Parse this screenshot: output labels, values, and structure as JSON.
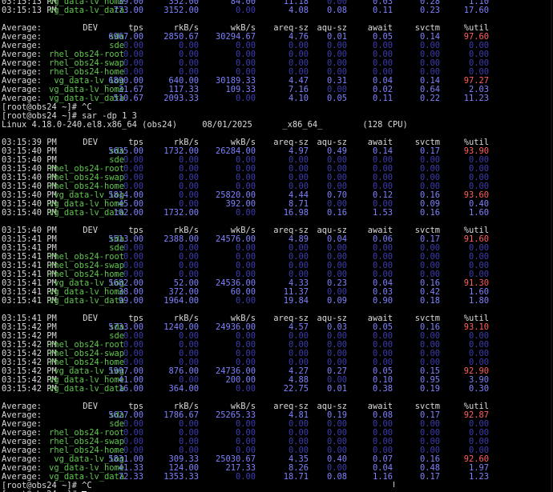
{
  "terminal": {
    "prompt": "[root@obs24 ~]# ",
    "lines": [
      {
        "k": "row",
        "time": "03:15:13 PM",
        "dev": "vg_data-lv_home",
        "v": [
          "39.00",
          "352.00",
          "84.00",
          "11.18",
          "0.00",
          "0.03",
          "0.28",
          "1.10"
        ]
      },
      {
        "k": "row",
        "time": "03:15:13 PM",
        "dev": "vg_data-lv_data",
        "v": [
          "773.00",
          "3152.00",
          "0.00",
          "4.08",
          "0.08",
          "0.11",
          "0.23",
          "17.60"
        ]
      },
      {
        "k": "blank"
      },
      {
        "k": "header",
        "time": "Average:",
        "cols": [
          "DEV",
          "tps",
          "rkB/s",
          "wkB/s",
          "areq-sz",
          "aqu-sz",
          "await",
          "svctm",
          "%util"
        ]
      },
      {
        "k": "row",
        "time": "Average:",
        "dev": "sda",
        "v": [
          "6967.00",
          "2850.67",
          "30294.67",
          "4.76",
          "0.01",
          "0.05",
          "0.14",
          "97.60"
        ]
      },
      {
        "k": "row",
        "time": "Average:",
        "dev": "sde",
        "v": [
          "0.00",
          "0.00",
          "0.00",
          "0.00",
          "0.00",
          "0.00",
          "0.00",
          "0.00"
        ]
      },
      {
        "k": "row",
        "time": "Average:",
        "dev": "rhel_obs24-root",
        "v": [
          "0.00",
          "0.00",
          "0.00",
          "0.00",
          "0.00",
          "0.00",
          "0.00",
          "0.00"
        ]
      },
      {
        "k": "row",
        "time": "Average:",
        "dev": "rhel_obs24-swap",
        "v": [
          "0.00",
          "0.00",
          "0.00",
          "0.00",
          "0.00",
          "0.00",
          "0.00",
          "0.00"
        ]
      },
      {
        "k": "row",
        "time": "Average:",
        "dev": "rhel_obs24-home",
        "v": [
          "0.00",
          "0.00",
          "0.00",
          "0.00",
          "0.00",
          "0.00",
          "0.00",
          "0.00"
        ]
      },
      {
        "k": "row",
        "time": "Average:",
        "dev": "vg_data-lv_log",
        "v": [
          "6890.00",
          "640.00",
          "30189.33",
          "4.47",
          "0.31",
          "0.04",
          "0.14",
          "97.27"
        ]
      },
      {
        "k": "row",
        "time": "Average:",
        "dev": "vg_data-lv_home",
        "v": [
          "31.67",
          "117.33",
          "109.33",
          "7.16",
          "0.00",
          "0.02",
          "0.64",
          "2.03"
        ]
      },
      {
        "k": "row",
        "time": "Average:",
        "dev": "vg_data-lv_data",
        "v": [
          "510.67",
          "2093.33",
          "0.00",
          "4.10",
          "0.05",
          "0.11",
          "0.22",
          "11.23"
        ]
      },
      {
        "k": "cmd",
        "text": "^C"
      },
      {
        "k": "cmd",
        "text": "sar -dp 1 3"
      },
      {
        "k": "text",
        "text": "Linux 4.18.0-240.el8.x86_64 (obs24)     08/01/2025      _x86_64_        (128 CPU)"
      },
      {
        "k": "blank"
      },
      {
        "k": "header",
        "time": "03:15:39 PM",
        "cols": [
          "DEV",
          "tps",
          "rkB/s",
          "wkB/s",
          "areq-sz",
          "aqu-sz",
          "await",
          "svctm",
          "%util"
        ]
      },
      {
        "k": "row",
        "time": "03:15:40 PM",
        "dev": "sda",
        "v": [
          "5635.00",
          "1732.00",
          "26284.00",
          "4.97",
          "0.49",
          "0.14",
          "0.17",
          "93.90"
        ]
      },
      {
        "k": "row",
        "time": "03:15:40 PM",
        "dev": "sde",
        "v": [
          "0.00",
          "0.00",
          "0.00",
          "0.00",
          "0.00",
          "0.00",
          "0.00",
          "0.00"
        ]
      },
      {
        "k": "row",
        "time": "03:15:40 PM",
        "dev": "rhel_obs24-root",
        "v": [
          "0.00",
          "0.00",
          "0.00",
          "0.00",
          "0.00",
          "0.00",
          "0.00",
          "0.00"
        ]
      },
      {
        "k": "row",
        "time": "03:15:40 PM",
        "dev": "rhel_obs24-swap",
        "v": [
          "0.00",
          "0.00",
          "0.00",
          "0.00",
          "0.00",
          "0.00",
          "0.00",
          "0.00"
        ]
      },
      {
        "k": "row",
        "time": "03:15:40 PM",
        "dev": "rhel_obs24-home",
        "v": [
          "0.00",
          "0.00",
          "0.00",
          "0.00",
          "0.00",
          "0.00",
          "0.00",
          "0.00"
        ]
      },
      {
        "k": "row",
        "time": "03:15:40 PM",
        "dev": "vg_data-lv_log",
        "v": [
          "5814.00",
          "0.00",
          "25820.00",
          "4.44",
          "0.70",
          "0.12",
          "0.16",
          "93.60"
        ]
      },
      {
        "k": "row",
        "time": "03:15:40 PM",
        "dev": "vg_data-lv_home",
        "v": [
          "45.00",
          "0.00",
          "392.00",
          "8.71",
          "0.00",
          "0.00",
          "0.09",
          "0.40"
        ]
      },
      {
        "k": "row",
        "time": "03:15:40 PM",
        "dev": "vg_data-lv_data",
        "v": [
          "102.00",
          "1732.00",
          "0.00",
          "16.98",
          "0.16",
          "1.53",
          "0.16",
          "1.60"
        ]
      },
      {
        "k": "blank"
      },
      {
        "k": "header",
        "time": "03:15:40 PM",
        "cols": [
          "DEV",
          "tps",
          "rkB/s",
          "wkB/s",
          "areq-sz",
          "aqu-sz",
          "await",
          "svctm",
          "%util"
        ]
      },
      {
        "k": "row",
        "time": "03:15:41 PM",
        "dev": "sda",
        "v": [
          "5513.00",
          "2388.00",
          "24576.00",
          "4.89",
          "0.04",
          "0.06",
          "0.17",
          "91.60"
        ]
      },
      {
        "k": "row",
        "time": "03:15:41 PM",
        "dev": "sde",
        "v": [
          "0.00",
          "0.00",
          "0.00",
          "0.00",
          "0.00",
          "0.00",
          "0.00",
          "0.00"
        ]
      },
      {
        "k": "row",
        "time": "03:15:41 PM",
        "dev": "rhel_obs24-root",
        "v": [
          "0.00",
          "0.00",
          "0.00",
          "0.00",
          "0.00",
          "0.00",
          "0.00",
          "0.00"
        ]
      },
      {
        "k": "row",
        "time": "03:15:41 PM",
        "dev": "rhel_obs24-swap",
        "v": [
          "0.00",
          "0.00",
          "0.00",
          "0.00",
          "0.00",
          "0.00",
          "0.00",
          "0.00"
        ]
      },
      {
        "k": "row",
        "time": "03:15:41 PM",
        "dev": "rhel_obs24-home",
        "v": [
          "0.00",
          "0.00",
          "0.00",
          "0.00",
          "0.00",
          "0.00",
          "0.00",
          "0.00"
        ]
      },
      {
        "k": "row",
        "time": "03:15:41 PM",
        "dev": "vg_data-lv_log",
        "v": [
          "5682.00",
          "52.00",
          "24536.00",
          "4.33",
          "0.23",
          "0.04",
          "0.16",
          "91.30"
        ]
      },
      {
        "k": "row",
        "time": "03:15:41 PM",
        "dev": "vg_data-lv_home",
        "v": [
          "38.00",
          "372.00",
          "60.00",
          "11.37",
          "0.00",
          "0.03",
          "0.42",
          "1.60"
        ]
      },
      {
        "k": "row",
        "time": "03:15:41 PM",
        "dev": "vg_data-lv_data",
        "v": [
          "99.00",
          "1964.00",
          "0.00",
          "19.84",
          "0.09",
          "0.90",
          "0.18",
          "1.80"
        ]
      },
      {
        "k": "blank"
      },
      {
        "k": "header",
        "time": "03:15:41 PM",
        "cols": [
          "DEV",
          "tps",
          "rkB/s",
          "wkB/s",
          "areq-sz",
          "aqu-sz",
          "await",
          "svctm",
          "%util"
        ]
      },
      {
        "k": "row",
        "time": "03:15:42 PM",
        "dev": "sda",
        "v": [
          "5733.00",
          "1240.00",
          "24936.00",
          "4.57",
          "0.03",
          "0.05",
          "0.16",
          "93.10"
        ]
      },
      {
        "k": "row",
        "time": "03:15:42 PM",
        "dev": "sde",
        "v": [
          "0.00",
          "0.00",
          "0.00",
          "0.00",
          "0.00",
          "0.00",
          "0.00",
          "0.00"
        ]
      },
      {
        "k": "row",
        "time": "03:15:42 PM",
        "dev": "rhel_obs24-root",
        "v": [
          "0.00",
          "0.00",
          "0.00",
          "0.00",
          "0.00",
          "0.00",
          "0.00",
          "0.00"
        ]
      },
      {
        "k": "row",
        "time": "03:15:42 PM",
        "dev": "rhel_obs24-swap",
        "v": [
          "0.00",
          "0.00",
          "0.00",
          "0.00",
          "0.00",
          "0.00",
          "0.00",
          "0.00"
        ]
      },
      {
        "k": "row",
        "time": "03:15:42 PM",
        "dev": "rhel_obs24-home",
        "v": [
          "0.00",
          "0.00",
          "0.00",
          "0.00",
          "0.00",
          "0.00",
          "0.00",
          "0.00"
        ]
      },
      {
        "k": "row",
        "time": "03:15:42 PM",
        "dev": "vg_data-lv_log",
        "v": [
          "5997.00",
          "876.00",
          "24736.00",
          "4.27",
          "0.27",
          "0.05",
          "0.15",
          "92.90"
        ]
      },
      {
        "k": "row",
        "time": "03:15:42 PM",
        "dev": "vg_data-lv_home",
        "v": [
          "41.00",
          "0.00",
          "200.00",
          "4.88",
          "0.00",
          "0.10",
          "0.95",
          "3.90"
        ]
      },
      {
        "k": "row",
        "time": "03:15:42 PM",
        "dev": "vg_data-lv_data",
        "v": [
          "16.00",
          "364.00",
          "0.00",
          "22.75",
          "0.01",
          "0.38",
          "0.19",
          "0.30"
        ]
      },
      {
        "k": "blank"
      },
      {
        "k": "header",
        "time": "Average:",
        "cols": [
          "DEV",
          "tps",
          "rkB/s",
          "wkB/s",
          "areq-sz",
          "aqu-sz",
          "await",
          "svctm",
          "%util"
        ]
      },
      {
        "k": "row",
        "time": "Average:",
        "dev": "sda",
        "v": [
          "5627.00",
          "1786.67",
          "25265.33",
          "4.81",
          "0.19",
          "0.08",
          "0.17",
          "92.87"
        ]
      },
      {
        "k": "row",
        "time": "Average:",
        "dev": "sde",
        "v": [
          "0.00",
          "0.00",
          "0.00",
          "0.00",
          "0.00",
          "0.00",
          "0.00",
          "0.00"
        ]
      },
      {
        "k": "row",
        "time": "Average:",
        "dev": "rhel_obs24-root",
        "v": [
          "0.00",
          "0.00",
          "0.00",
          "0.00",
          "0.00",
          "0.00",
          "0.00",
          "0.00"
        ]
      },
      {
        "k": "row",
        "time": "Average:",
        "dev": "rhel_obs24-swap",
        "v": [
          "0.00",
          "0.00",
          "0.00",
          "0.00",
          "0.00",
          "0.00",
          "0.00",
          "0.00"
        ]
      },
      {
        "k": "row",
        "time": "Average:",
        "dev": "rhel_obs24-home",
        "v": [
          "0.00",
          "0.00",
          "0.00",
          "0.00",
          "0.00",
          "0.00",
          "0.00",
          "0.00"
        ]
      },
      {
        "k": "row",
        "time": "Average:",
        "dev": "vg_data-lv_log",
        "v": [
          "5831.00",
          "309.33",
          "25030.67",
          "4.35",
          "0.40",
          "0.07",
          "0.16",
          "92.60"
        ]
      },
      {
        "k": "row",
        "time": "Average:",
        "dev": "vg_data-lv_home",
        "v": [
          "41.33",
          "124.00",
          "217.33",
          "8.26",
          "0.00",
          "0.04",
          "0.48",
          "1.97"
        ]
      },
      {
        "k": "row",
        "time": "Average:",
        "dev": "vg_data-lv_data",
        "v": [
          "72.33",
          "1353.33",
          "0.00",
          "18.71",
          "0.08",
          "1.16",
          "0.17",
          "1.23"
        ]
      },
      {
        "k": "cmd",
        "text": "^C"
      },
      {
        "k": "cmd",
        "text": "",
        "cursor": true
      }
    ]
  },
  "colors": {
    "background": "#000000",
    "text": "#d9d9d9",
    "value": "#7f82ff",
    "zero": "#3c3cb0",
    "device": "#5fc84d",
    "high_util": "#ff5f5f"
  }
}
